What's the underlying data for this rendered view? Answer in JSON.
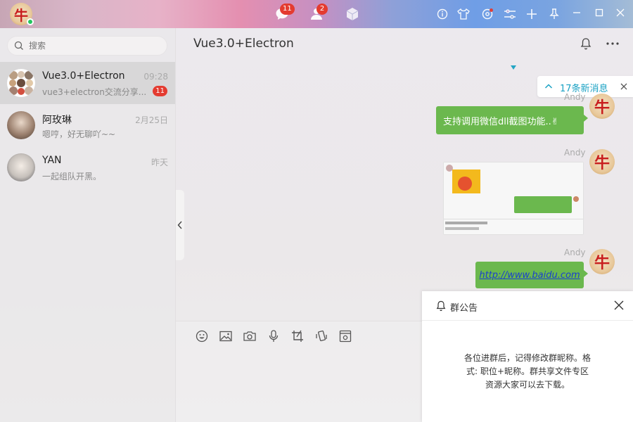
{
  "topbar": {
    "chat_badge": "11",
    "contacts_badge": "2",
    "icons": [
      "chat-icon",
      "contacts-icon",
      "box-icon",
      "info-icon",
      "skin-icon",
      "settings-icon",
      "sliders-icon",
      "plus-icon",
      "pin-icon",
      "minimize-icon",
      "maximize-icon",
      "close-icon"
    ]
  },
  "sidebar": {
    "search_placeholder": "搜索",
    "chats": [
      {
        "name": "Vue3.0+Electron",
        "time": "09:28",
        "preview": "vue3+electron交流分享...",
        "badge": "11"
      },
      {
        "name": "阿玫琳",
        "time": "2月25日",
        "preview": "嗯哼，好无聊吖~~"
      },
      {
        "name": "YAN",
        "time": "昨天",
        "preview": "一起组队开黑。"
      }
    ]
  },
  "main": {
    "title": "Vue3.0+Electron",
    "new_messages": "17条新消息",
    "messages": [
      {
        "sender": "Andy",
        "text": "支持调用微信dll截图功能..✌"
      },
      {
        "sender": "Andy",
        "type": "image"
      },
      {
        "sender": "Andy",
        "link": "http://www.baidu.com"
      }
    ]
  },
  "notice": {
    "title": "群公告",
    "body_line1": "各位进群后，记得修改群昵称。格",
    "body_line2": "式: 职位+昵称。群共享文件专区",
    "body_line3": "资源大家可以去下载。"
  },
  "colors": {
    "accent": "#1ba2c4",
    "bubble": "#6bb84e",
    "badge": "#e43b30"
  }
}
